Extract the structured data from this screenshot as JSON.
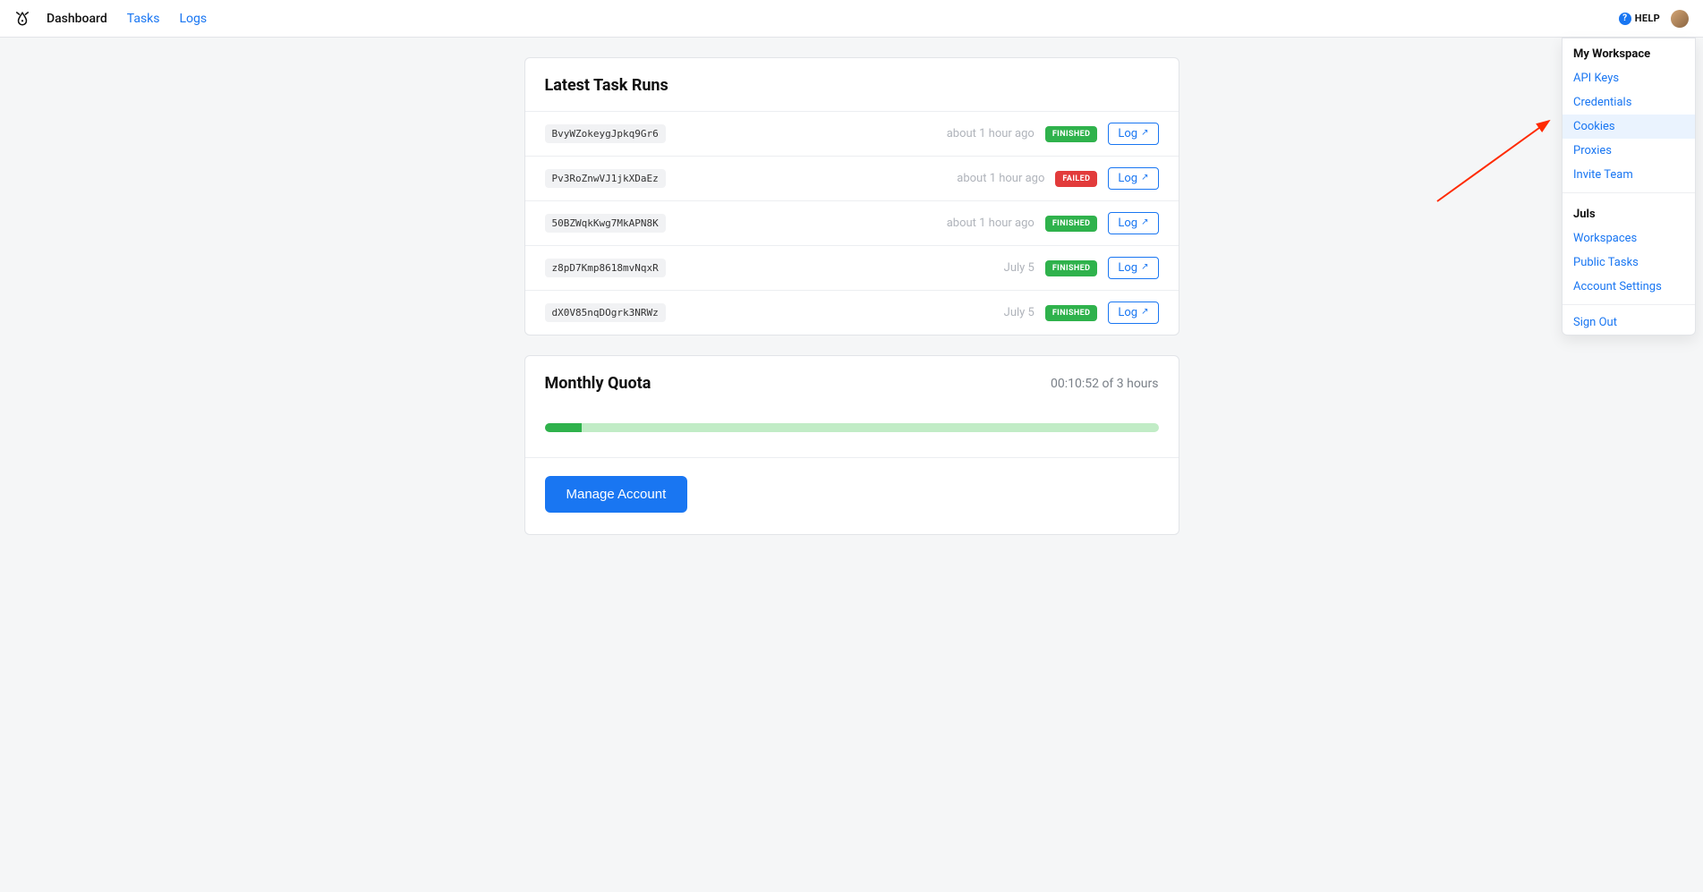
{
  "nav": {
    "dashboard": "Dashboard",
    "tasks": "Tasks",
    "logs": "Logs"
  },
  "topbar": {
    "help_label": "HELP"
  },
  "sections": {
    "latest_runs_title": "Latest Task Runs",
    "monthly_quota_title": "Monthly Quota"
  },
  "statuses": {
    "finished": "FINISHED",
    "failed": "FAILED"
  },
  "buttons": {
    "log": "Log",
    "manage_account": "Manage Account"
  },
  "tasks": [
    {
      "id": "BvyWZokeygJpkq9Gr6",
      "time": "about 1 hour ago",
      "status_key": "finished"
    },
    {
      "id": "Pv3RoZnwVJ1jkXDaEz",
      "time": "about 1 hour ago",
      "status_key": "failed"
    },
    {
      "id": "50BZWqkKwg7MkAPN8K",
      "time": "about 1 hour ago",
      "status_key": "finished"
    },
    {
      "id": "z8pD7Kmp8618mvNqxR",
      "time": "July 5",
      "status_key": "finished"
    },
    {
      "id": "dX0V85nqDOgrk3NRWz",
      "time": "July 5",
      "status_key": "finished"
    }
  ],
  "quota": {
    "text": "00:10:52 of 3 hours",
    "percent": 6
  },
  "dropdown": {
    "section1_title": "My Workspace",
    "section1_items": [
      "API Keys",
      "Credentials",
      "Cookies",
      "Proxies",
      "Invite Team"
    ],
    "highlight_index": 2,
    "section2_title": "Juls",
    "section2_items": [
      "Workspaces",
      "Public Tasks",
      "Account Settings"
    ],
    "section3_items": [
      "Sign Out"
    ]
  }
}
